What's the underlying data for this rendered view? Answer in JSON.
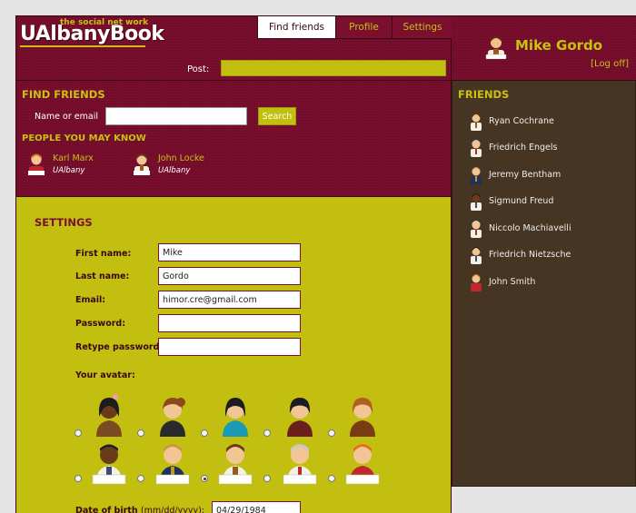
{
  "app": {
    "logo_main_1": "UAlbany",
    "logo_main_2": "Book",
    "logo_tagline": "the social net work"
  },
  "nav": {
    "tabs": [
      {
        "label": "Find friends",
        "active": true
      },
      {
        "label": "Profile",
        "active": false
      },
      {
        "label": "Settings",
        "active": false
      }
    ]
  },
  "post": {
    "label": "Post:",
    "value": ""
  },
  "user": {
    "name": "Mike Gordo",
    "logoff_label": "[Log off]"
  },
  "find_friends": {
    "title": "FIND FRIENDS",
    "field_label": "Name or email",
    "field_value": "",
    "search_label": "Search",
    "pymk_title": "PEOPLE YOU MAY KNOW",
    "suggestions": [
      {
        "name": "Karl Marx",
        "school": "UAlbany"
      },
      {
        "name": "John Locke",
        "school": "UAlbany"
      }
    ]
  },
  "settings": {
    "title": "SETTINGS",
    "fields": [
      {
        "label": "First name:",
        "value": "Mike"
      },
      {
        "label": "Last name:",
        "value": "Gordo"
      },
      {
        "label": "Email:",
        "value": "himor.cre@gmail.com"
      },
      {
        "label": "Password:",
        "value": ""
      },
      {
        "label": "Retype password:",
        "value": ""
      }
    ],
    "avatar_label": "Your avatar:",
    "avatar_selected_index": 7,
    "dob_label": "Date of birth",
    "dob_hint": "(mm/dd/yyyy):",
    "dob_value": "04/29/1984"
  },
  "friends": {
    "title": "FRIENDS",
    "items": [
      "Ryan Cochrane",
      "Friedrich Engels",
      "Jeremy Bentham",
      "Sigmund Freud",
      "Niccolo Machiavelli",
      "Friedrich Nietzsche",
      "John Smith"
    ]
  },
  "colors": {
    "maroon": "#7a0f2e",
    "olive": "#c2bf10",
    "brown": "#463522",
    "accent_text": "#c8c112"
  }
}
